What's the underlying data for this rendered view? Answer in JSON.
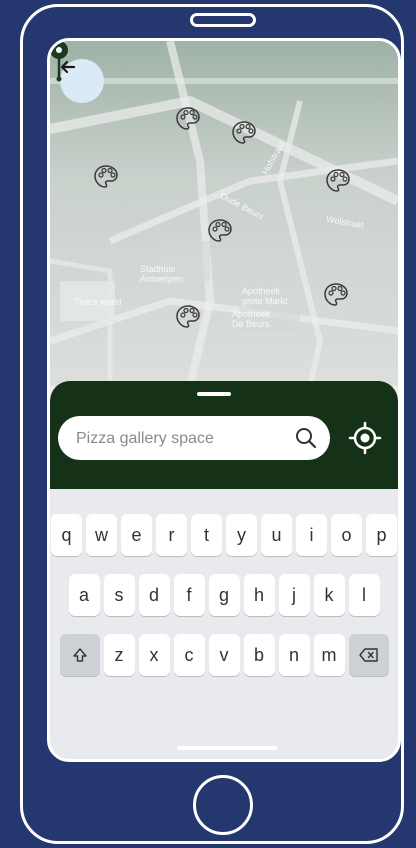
{
  "map": {
    "labels": {
      "street1": "Oude Beurs",
      "street2": "Wolstraat",
      "street3": "Hofstraat",
      "stadhuis": "Stadhuis\nAntwerpen",
      "apotheek1": "Apotheek\ngrote Markt",
      "apotheek2": "Apotheek\nDe Beurs",
      "pinlabel": "Tina's world"
    },
    "icons": {
      "back": "arrow-left-icon",
      "marker": "palette-icon",
      "pin": "map-pin-icon"
    }
  },
  "search": {
    "placeholder": "Pizza gallery space",
    "search_icon": "search-icon",
    "locate_icon": "my-location-icon"
  },
  "keyboard": {
    "row1": [
      "q",
      "w",
      "e",
      "r",
      "t",
      "y",
      "u",
      "i",
      "o",
      "p"
    ],
    "row2": [
      "a",
      "s",
      "d",
      "f",
      "g",
      "h",
      "j",
      "k",
      "l"
    ],
    "row3": [
      "z",
      "x",
      "c",
      "v",
      "b",
      "n",
      "m"
    ],
    "shift_icon": "shift-icon",
    "backspace_icon": "backspace-icon"
  },
  "colors": {
    "background": "#24376f",
    "panel": "#153219",
    "back_button": "#dbeaf7",
    "pin": "#1c3a22"
  }
}
